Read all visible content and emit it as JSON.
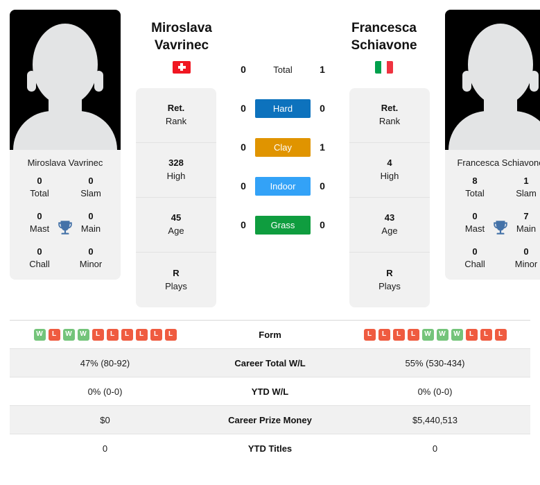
{
  "players": {
    "left": {
      "first_name": "Miroslava",
      "last_name": "Vavrinec",
      "full_name": "Miroslava Vavrinec",
      "country": "Switzerland",
      "flag": "flag-switzerland",
      "rank": "Ret.",
      "rank_label": "Rank",
      "high": "328",
      "high_label": "High",
      "age": "45",
      "age_label": "Age",
      "plays": "R",
      "plays_label": "Plays",
      "titles": {
        "total": "0",
        "total_label": "Total",
        "slam": "0",
        "slam_label": "Slam",
        "mast": "0",
        "mast_label": "Mast",
        "main": "0",
        "main_label": "Main",
        "chall": "0",
        "chall_label": "Chall",
        "minor": "0",
        "minor_label": "Minor"
      },
      "form": [
        "W",
        "L",
        "W",
        "W",
        "L",
        "L",
        "L",
        "L",
        "L",
        "L"
      ],
      "career_total_wl": "47% (80-92)",
      "ytd_wl": "0% (0-0)",
      "career_prize_money": "$0",
      "ytd_titles": "0"
    },
    "right": {
      "first_name": "Francesca",
      "last_name": "Schiavone",
      "full_name": "Francesca Schiavone",
      "country": "Italy",
      "flag": "flag-italy",
      "rank": "Ret.",
      "rank_label": "Rank",
      "high": "4",
      "high_label": "High",
      "age": "43",
      "age_label": "Age",
      "plays": "R",
      "plays_label": "Plays",
      "titles": {
        "total": "8",
        "total_label": "Total",
        "slam": "1",
        "slam_label": "Slam",
        "mast": "0",
        "mast_label": "Mast",
        "main": "7",
        "main_label": "Main",
        "chall": "0",
        "chall_label": "Chall",
        "minor": "0",
        "minor_label": "Minor"
      },
      "form": [
        "L",
        "L",
        "L",
        "L",
        "W",
        "W",
        "W",
        "L",
        "L",
        "L"
      ],
      "career_total_wl": "55% (530-434)",
      "ytd_wl": "0% (0-0)",
      "career_prize_money": "$5,440,513",
      "ytd_titles": "0"
    }
  },
  "head_to_head": [
    {
      "label": "Total",
      "left": "0",
      "right": "1",
      "color": "none"
    },
    {
      "label": "Hard",
      "left": "0",
      "right": "0",
      "color": "#0d72bd"
    },
    {
      "label": "Clay",
      "left": "0",
      "right": "1",
      "color": "#e09400"
    },
    {
      "label": "Indoor",
      "left": "0",
      "right": "0",
      "color": "#33a2f7"
    },
    {
      "label": "Grass",
      "left": "0",
      "right": "0",
      "color": "#0f9d3f"
    }
  ],
  "comparison_rows": [
    {
      "label": "Form",
      "left": "",
      "right": "",
      "type": "form"
    },
    {
      "label": "Career Total W/L",
      "left": "47% (80-92)",
      "right": "55% (530-434)",
      "type": "text"
    },
    {
      "label": "YTD W/L",
      "left": "0% (0-0)",
      "right": "0% (0-0)",
      "type": "text"
    },
    {
      "label": "Career Prize Money",
      "left": "$0",
      "right": "$5,440,513",
      "type": "text"
    },
    {
      "label": "YTD Titles",
      "left": "0",
      "right": "0",
      "type": "text"
    }
  ],
  "colors": {
    "hard": "#0d72bd",
    "clay": "#e09400",
    "indoor": "#33a2f7",
    "grass": "#0f9d3f",
    "win": "#74c47a",
    "loss": "#ef5b40",
    "trophy": "#4472a8",
    "card_bg": "#f1f1f1"
  }
}
